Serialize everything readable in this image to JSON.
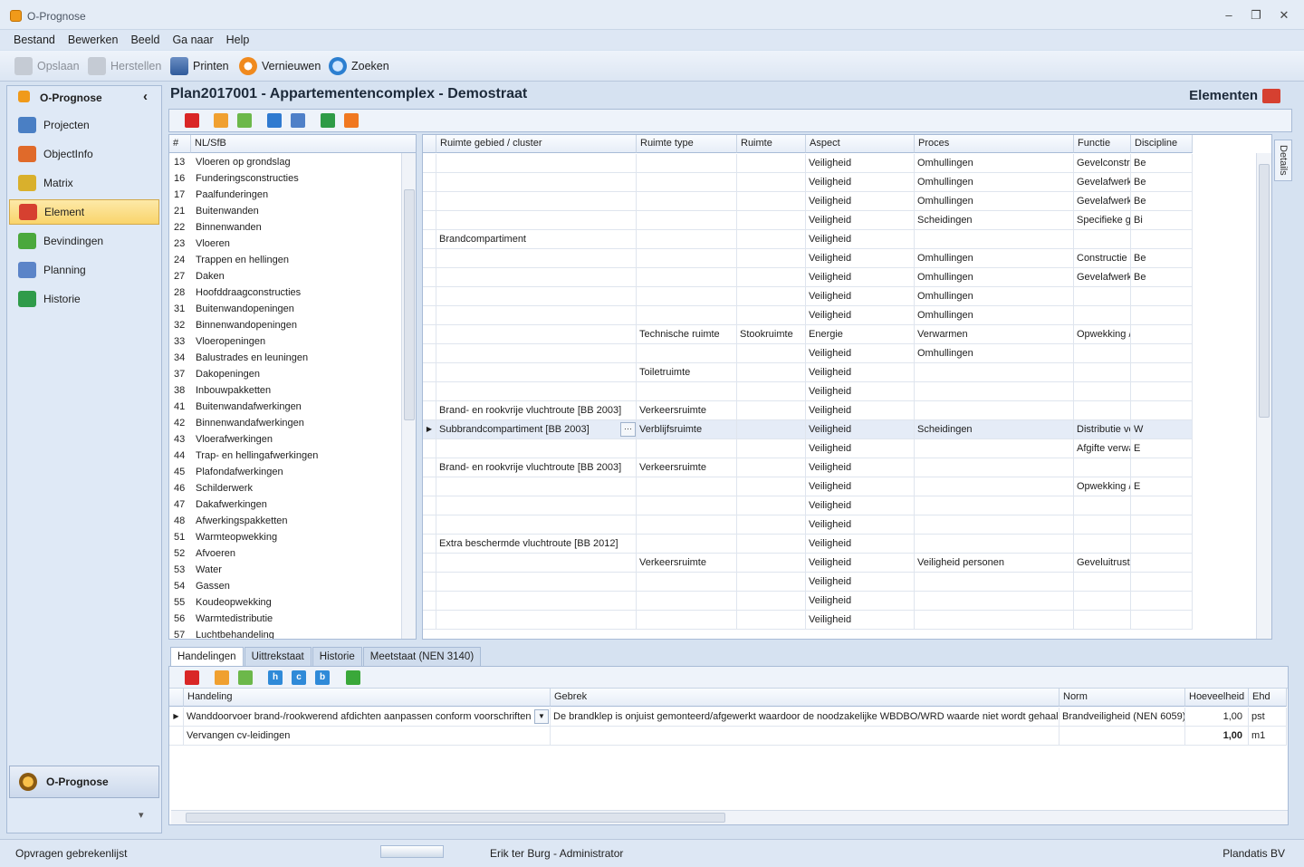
{
  "window": {
    "title": "O-Prognose",
    "minimize": "▭",
    "restore": "❐",
    "close": "✕"
  },
  "menu": [
    "Bestand",
    "Bewerken",
    "Beeld",
    "Ga naar",
    "Help"
  ],
  "toolbar": {
    "save": "Opslaan",
    "restore": "Herstellen",
    "print": "Printen",
    "refresh": "Vernieuwen",
    "search": "Zoeken"
  },
  "nav": {
    "title": "O-Prognose",
    "collapse": "‹",
    "items": [
      {
        "label": "Projecten",
        "icon": "projects-icon",
        "color": "#4a7fc4"
      },
      {
        "label": "ObjectInfo",
        "icon": "house-icon",
        "color": "#e06a2a"
      },
      {
        "label": "Matrix",
        "icon": "matrix-folder-icon",
        "color": "#d9b02c"
      },
      {
        "label": "Element",
        "icon": "element-folder-icon",
        "color": "#d64030"
      },
      {
        "label": "Bevindingen",
        "icon": "findings-folder-icon",
        "color": "#4aa83c"
      },
      {
        "label": "Planning",
        "icon": "calendar-icon",
        "color": "#5b84c8"
      },
      {
        "label": "Historie",
        "icon": "history-icon",
        "color": "#2f9b4a"
      }
    ],
    "bottom_label": "O-Prognose",
    "bottom_arrow": "▾"
  },
  "header": {
    "title": "Plan2017001 - Appartementencomplex - Demostraat",
    "right": "Elementen"
  },
  "codelist": {
    "headers": [
      "#",
      "NL/SfB"
    ],
    "rows": [
      [
        "13",
        "Vloeren op grondslag"
      ],
      [
        "16",
        "Funderingsconstructies"
      ],
      [
        "17",
        "Paalfunderingen"
      ],
      [
        "21",
        "Buitenwanden"
      ],
      [
        "22",
        "Binnenwanden"
      ],
      [
        "23",
        "Vloeren"
      ],
      [
        "24",
        "Trappen en hellingen"
      ],
      [
        "27",
        "Daken"
      ],
      [
        "28",
        "Hoofddraagconstructies"
      ],
      [
        "31",
        "Buitenwandopeningen"
      ],
      [
        "32",
        "Binnenwandopeningen"
      ],
      [
        "33",
        "Vloeropeningen"
      ],
      [
        "34",
        "Balustrades en leuningen"
      ],
      [
        "37",
        "Dakopeningen"
      ],
      [
        "38",
        "Inbouwpakketten"
      ],
      [
        "41",
        "Buitenwandafwerkingen"
      ],
      [
        "42",
        "Binnenwandafwerkingen"
      ],
      [
        "43",
        "Vloerafwerkingen"
      ],
      [
        "44",
        "Trap- en hellingafwerkingen"
      ],
      [
        "45",
        "Plafondafwerkingen"
      ],
      [
        "46",
        "Schilderwerk"
      ],
      [
        "47",
        "Dakafwerkingen"
      ],
      [
        "48",
        "Afwerkingspakketten"
      ],
      [
        "51",
        "Warmteopwekking"
      ],
      [
        "52",
        "Afvoeren"
      ],
      [
        "53",
        "Water"
      ],
      [
        "54",
        "Gassen"
      ],
      [
        "55",
        "Koudeopwekking"
      ],
      [
        "56",
        "Warmtedistributie"
      ],
      [
        "57",
        "Luchtbehandeling"
      ]
    ]
  },
  "maingrid": {
    "headers": [
      "Ruimte gebied / cluster",
      "Ruimte type",
      "Ruimte",
      "Aspect",
      "Proces",
      "Functie",
      "Discipline"
    ],
    "rows": [
      [
        "",
        "",
        "",
        "Veiligheid",
        "Omhullingen",
        "Gevelconstructies",
        "Be"
      ],
      [
        "",
        "",
        "",
        "Veiligheid",
        "Omhullingen",
        "Gevelafwerkingen",
        "Be"
      ],
      [
        "",
        "",
        "",
        "Veiligheid",
        "Omhullingen",
        "Gevelafwerkingen",
        "Be"
      ],
      [
        "",
        "",
        "",
        "Veiligheid",
        "Scheidingen",
        "Specifieke gebruikersinrichtingen",
        "Bi"
      ],
      [
        "Brandcompartiment",
        "",
        "",
        "Veiligheid",
        "",
        "",
        ""
      ],
      [
        "",
        "",
        "",
        "Veiligheid",
        "Omhullingen",
        "Constructie gevelopeningen",
        "Be"
      ],
      [
        "",
        "",
        "",
        "Veiligheid",
        "Omhullingen",
        "Gevelafwerkingen",
        "Be"
      ],
      [
        "",
        "",
        "",
        "Veiligheid",
        "Omhullingen",
        "",
        ""
      ],
      [
        "",
        "",
        "",
        "Veiligheid",
        "Omhullingen",
        "",
        ""
      ],
      [
        "",
        "Technische ruimte",
        "Stookruimte",
        "Energie",
        "Verwarmen",
        "Opwekking / omzetting verwarmen",
        ""
      ],
      [
        "",
        "",
        "",
        "Veiligheid",
        "Omhullingen",
        "",
        ""
      ],
      [
        "",
        "Toiletruimte",
        "",
        "Veiligheid",
        "",
        "",
        ""
      ],
      [
        "",
        "",
        "",
        "Veiligheid",
        "",
        "",
        ""
      ],
      [
        "Brand- en rookvrije vluchtroute [BB 2003]",
        "Verkeersruimte",
        "",
        "Veiligheid",
        "",
        "",
        ""
      ],
      [
        "Subbrandcompartiment [BB 2003]",
        "Verblijfsruimte",
        "",
        "Veiligheid",
        "Scheidingen",
        "Distributie verwarmen",
        "W"
      ],
      [
        "",
        "",
        "",
        "Veiligheid",
        "",
        "Afgifte verwarmen",
        "E"
      ],
      [
        "Brand- en rookvrije vluchtroute [BB 2003]",
        "Verkeersruimte",
        "",
        "Veiligheid",
        "",
        "",
        ""
      ],
      [
        "",
        "",
        "",
        "Veiligheid",
        "",
        "Opwekking / omzetting koelen",
        "E"
      ],
      [
        "",
        "",
        "",
        "Veiligheid",
        "",
        "",
        ""
      ],
      [
        "",
        "",
        "",
        "Veiligheid",
        "",
        "",
        ""
      ],
      [
        "Extra beschermde vluchtroute [BB 2012]",
        "",
        "",
        "Veiligheid",
        "",
        "",
        ""
      ],
      [
        "",
        "Verkeersruimte",
        "",
        "Veiligheid",
        "Veiligheid personen",
        "Geveluitrustingen",
        ""
      ],
      [
        "",
        "",
        "",
        "Veiligheid",
        "",
        "",
        ""
      ],
      [
        "",
        "",
        "",
        "Veiligheid",
        "",
        "",
        ""
      ],
      [
        "",
        "",
        "",
        "Veiligheid",
        "",
        "",
        ""
      ]
    ],
    "ellipsis": "···",
    "details_tab": "Details"
  },
  "bottomtabs": [
    "Handelingen",
    "Uittrekstaat",
    "Historie",
    "Meetstaat (NEN 3140)"
  ],
  "handelingen": {
    "headers": [
      "Handeling",
      "Gebrek",
      "Norm",
      "Hoeveelheid",
      "Ehd"
    ],
    "rows": [
      [
        "Wanddoorvoer brand-/rookwerend afdichten aanpassen conform voorschriften",
        "De brandklep is onjuist gemonteerd/afgewerkt waardoor de noodzakelijke WBDBO/WRD waarde niet wordt gehaald",
        "Brandveiligheid (NEN 6059)",
        "1,00",
        "pst"
      ],
      [
        "Vervangen cv-leidingen",
        "",
        "",
        "1,00",
        "m1"
      ]
    ],
    "buttons": [
      "h",
      "c",
      "b"
    ]
  },
  "status": {
    "left": "Opvragen gebrekenlijst",
    "user": "Erik ter Burg - Administrator",
    "right": "Plandatis BV"
  }
}
